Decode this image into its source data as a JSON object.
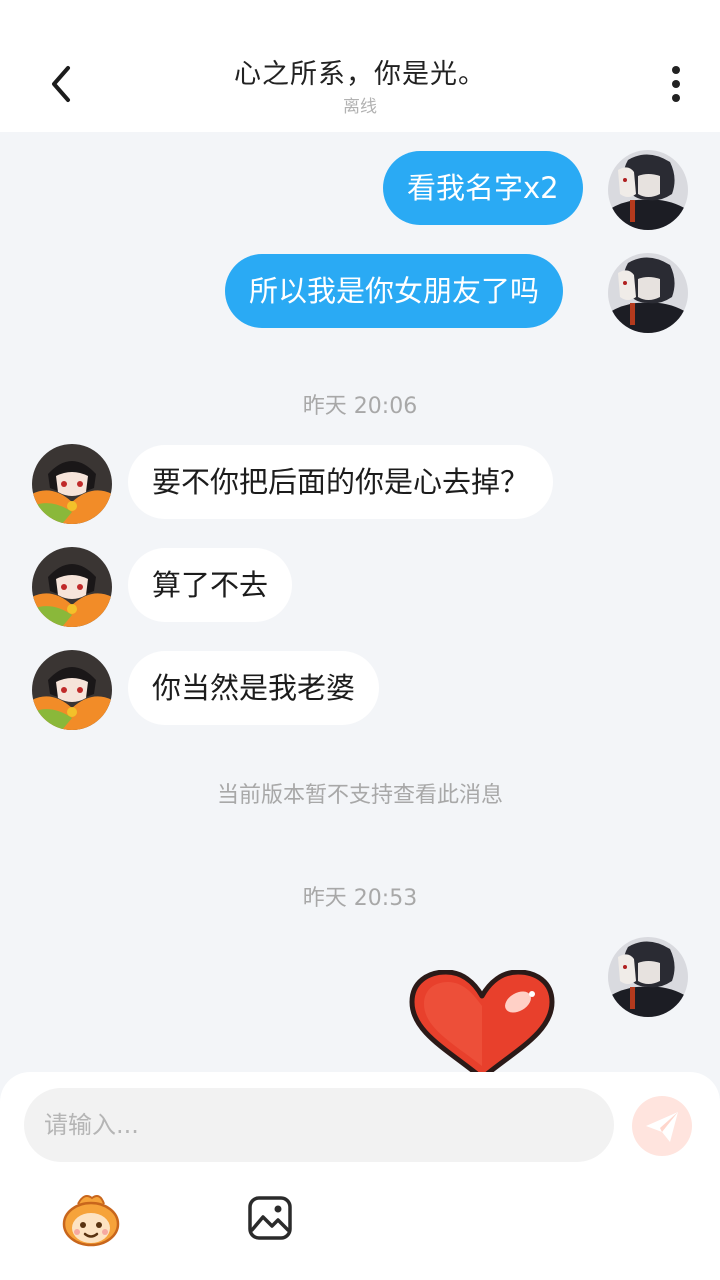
{
  "header": {
    "title": "心之所系，你是光。",
    "status": "离线"
  },
  "messages": [
    {
      "side": "me",
      "text": "看我名字x2"
    },
    {
      "side": "me",
      "text": "所以我是你女朋友了吗"
    },
    {
      "side": "them",
      "text": "要不你把后面的你是心去掉？"
    },
    {
      "side": "them",
      "text": "算了不去"
    },
    {
      "side": "them",
      "text": "你当然是我老婆"
    }
  ],
  "timestamps": [
    "昨天 20:06",
    "昨天 20:53"
  ],
  "system_message": "当前版本暂不支持查看此消息",
  "input": {
    "placeholder": "请输入..."
  },
  "colors": {
    "my_bubble": "#2aaaf4",
    "their_bubble": "#ffffff",
    "background": "#f3f5f8",
    "send_button": "#ffe4de",
    "heart": "#e8402c"
  },
  "icons": {
    "back": "chevron-left-icon",
    "more": "more-vertical-icon",
    "send": "paper-plane-icon",
    "emoji": "emoji-face-icon",
    "image": "image-icon",
    "sticker": "heart-sticker"
  }
}
